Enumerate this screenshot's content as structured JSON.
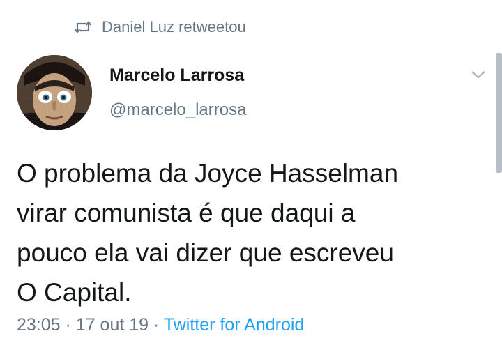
{
  "retweet": {
    "text": "Daniel Luz retweetou",
    "icon": "retweet-icon"
  },
  "author": {
    "name": "Marcelo Larrosa",
    "handle": "@marcelo_larrosa",
    "avatar_icon": "avatar-photo"
  },
  "tweet": {
    "lines": [
      "O problema da Joyce Hasselman",
      "virar comunista é que daqui a",
      "pouco ela vai dizer que escreveu",
      "O Capital."
    ]
  },
  "meta": {
    "time": "23:05",
    "date": "17 out 19",
    "separator": "·",
    "source": "Twitter for Android"
  },
  "colors": {
    "text": "#14171a",
    "secondary": "#657786",
    "link": "#1da1f2"
  }
}
